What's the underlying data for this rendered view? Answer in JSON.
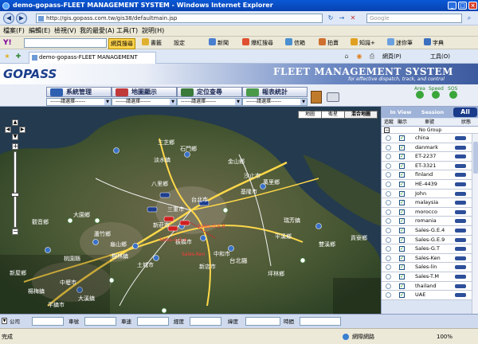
{
  "window": {
    "title": "demo-gopass-FLEET MANAGEMENT SYSTEM - Windows Internet Explorer"
  },
  "address_bar": {
    "url": "http://gis.gopass.com.tw/gis38/defaultmain.jsp",
    "search_placeholder": "Google"
  },
  "menu": {
    "items": [
      "檔案(F)",
      "編輯(E)",
      "檢視(V)",
      "我的最愛(A)",
      "工具(T)",
      "說明(H)"
    ]
  },
  "toolbar": {
    "yahoo_label": "Y!",
    "web_search": "網頁搜尋",
    "bookmarks": "書籤",
    "settings": "設定",
    "news": "新聞",
    "hot_search": "爆紅搜尋",
    "mail": "信箱",
    "auction": "拍賣",
    "knowledge": "知識+",
    "mini_buddy": "迷你筆",
    "dictionary": "字典"
  },
  "tab": {
    "label": "demo-gopass-FLEET MANAGEMENT SYSTEM"
  },
  "browser_right_tools": {
    "page_label": "網頁(P)",
    "tools_label": "工具(O)"
  },
  "app_header": {
    "logo": "GOPASS",
    "title": "FLEET MANAGEMENT SYSTEM",
    "subtitle": "for effective dispatch, track, and control"
  },
  "functions": [
    {
      "label": "系統管理",
      "select": "------請選擇------",
      "icon_color": "#2f5fb0"
    },
    {
      "label": "地圖顯示",
      "select": "------請選擇------",
      "icon_color": "#c03a3a"
    },
    {
      "label": "定位查尋",
      "select": "------請選擇------",
      "icon_color": "#3a7a3a"
    },
    {
      "label": "報表統計",
      "select": "------請選擇------",
      "icon_color": "#4a9a4a"
    }
  ],
  "status_indicators": [
    {
      "label": "Area",
      "color": "#3aa63a"
    },
    {
      "label": "Speed",
      "color": "#3aa63a"
    },
    {
      "label": "SOS",
      "color": "#3aa63a"
    }
  ],
  "map": {
    "tabs": [
      "地圖",
      "衛星",
      "混合地圖"
    ],
    "active_tab": "混合地圖",
    "place_labels": [
      {
        "text": "淡水鎮"
      },
      {
        "text": "八里鄉"
      },
      {
        "text": "三重市"
      },
      {
        "text": "新莊市"
      },
      {
        "text": "台北市"
      },
      {
        "text": "基隆市"
      },
      {
        "text": "汐止市"
      },
      {
        "text": "中和市"
      },
      {
        "text": "板橋市"
      },
      {
        "text": "樹林鎮"
      },
      {
        "text": "土城市"
      },
      {
        "text": "桃園縣"
      },
      {
        "text": "觀音鄉"
      },
      {
        "text": "大園鄉"
      },
      {
        "text": "蘆竹鄉"
      },
      {
        "text": "龜山鄉"
      },
      {
        "text": "大溪鎮"
      },
      {
        "text": "平溪鄉"
      },
      {
        "text": "雙溪鄉"
      },
      {
        "text": "貢寮鄉"
      },
      {
        "text": "瑞芳鎮"
      },
      {
        "text": "萬里鄉"
      },
      {
        "text": "金山鄉"
      },
      {
        "text": "石門鄉"
      },
      {
        "text": "三芝鄉"
      },
      {
        "text": "台北縣"
      },
      {
        "text": "新店市"
      },
      {
        "text": "坪林鄉"
      },
      {
        "text": "楊梅鎮"
      },
      {
        "text": "中壢市"
      },
      {
        "text": "平鎮市"
      },
      {
        "text": "新屋鄉"
      }
    ],
    "vehicle_labels": [
      {
        "text": "Sales-G.E.4"
      },
      {
        "text": "Sales-G.E.9"
      },
      {
        "text": "Sales-Ken"
      }
    ]
  },
  "panel": {
    "tabs": [
      "In View",
      "Session",
      "All"
    ],
    "headers": [
      "追蹤",
      "顯示",
      "車號",
      "狀態"
    ],
    "group": "No Group",
    "vehicles": [
      {
        "name": "china",
        "checked": true
      },
      {
        "name": "danmark",
        "checked": true
      },
      {
        "name": "ET-2237",
        "checked": true
      },
      {
        "name": "ET-3321",
        "checked": true
      },
      {
        "name": "finland",
        "checked": true
      },
      {
        "name": "HE-4439",
        "checked": true
      },
      {
        "name": "John",
        "checked": true
      },
      {
        "name": "malaysia",
        "checked": true
      },
      {
        "name": "morocco",
        "checked": true
      },
      {
        "name": "romania",
        "checked": true
      },
      {
        "name": "Sales-G.E.4",
        "checked": true
      },
      {
        "name": "Sales-G.E.9",
        "checked": true
      },
      {
        "name": "Sales-G.T",
        "checked": true
      },
      {
        "name": "Sales-Ken",
        "checked": true
      },
      {
        "name": "Sales-lin",
        "checked": true
      },
      {
        "name": "Sales-T.M",
        "checked": true
      },
      {
        "name": "thailand",
        "checked": true
      },
      {
        "name": "UAE",
        "checked": true
      }
    ]
  },
  "info_bar": {
    "labels": [
      "公司",
      "車號",
      "車速",
      "經度",
      "緯度",
      "時間"
    ]
  },
  "status_bar": {
    "left": "完成",
    "zone": "網際網路",
    "zoom": "100%"
  }
}
